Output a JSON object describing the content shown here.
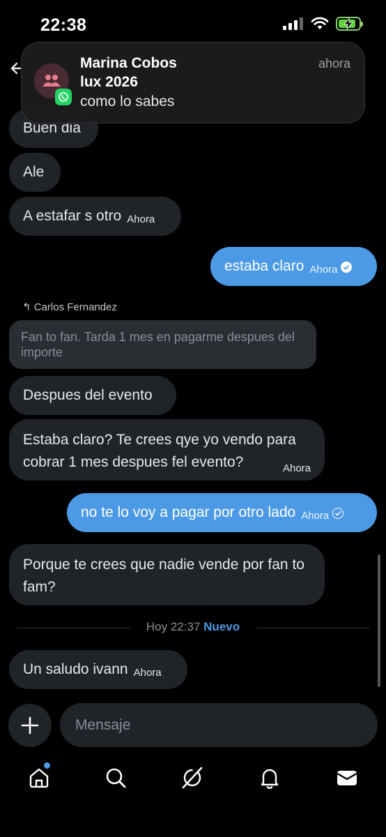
{
  "status_bar": {
    "time": "22:38"
  },
  "notification": {
    "sender": "Marina Cobos",
    "group": "lux 2026",
    "message": "como lo sabes",
    "time": "ahora",
    "app_icon": "whatsapp-icon"
  },
  "messages": [
    {
      "text": "Buen dia",
      "time": ""
    },
    {
      "text": "Ale",
      "time": ""
    },
    {
      "text": "A estafar s otro",
      "time": "Ahora"
    },
    {
      "text": "estaba claro",
      "time": "Ahora"
    },
    {
      "text": "Despues del evento",
      "time": ""
    },
    {
      "text": "Estaba claro? Te crees qye yo vendo para cobrar 1 mes despues fel evento?",
      "time": "Ahora"
    },
    {
      "text": "no te lo voy a pagar por otro lado",
      "time": "Ahora"
    },
    {
      "text": "Porque te crees que nadie vende por fan to fam?",
      "time": ""
    },
    {
      "text": "Un saludo ivann",
      "time": "Ahora"
    }
  ],
  "reply": {
    "author": "Carlos Fernandez",
    "quoted_text": "Fan to fan. Tarda 1 mes en pagarme despues del importe"
  },
  "divider": {
    "label": "Hoy 22:37",
    "new_label": "Nuevo"
  },
  "composer": {
    "placeholder": "Mensaje"
  },
  "tabs": [
    "home-icon",
    "search-icon",
    "grok-icon",
    "bell-icon",
    "mail-icon"
  ],
  "colors": {
    "accent": "#4c9ae6",
    "bubble_in": "#202327",
    "background": "#000000"
  }
}
